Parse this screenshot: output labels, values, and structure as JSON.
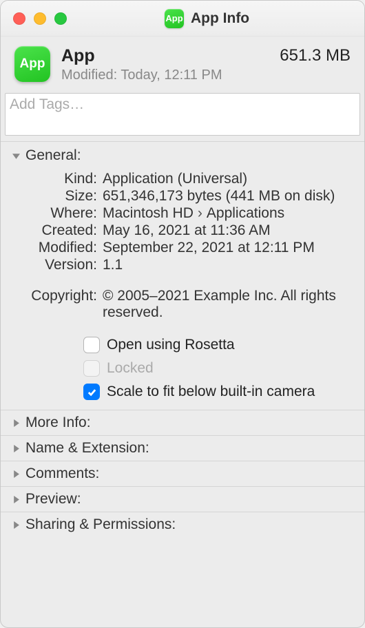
{
  "window": {
    "title": "App Info",
    "icon_text": "App"
  },
  "header": {
    "app_name": "App",
    "modified_label": "Modified:",
    "modified_value": "Today, 12:11 PM",
    "size": "651.3 MB",
    "icon_text": "App"
  },
  "tags": {
    "placeholder": "Add Tags…"
  },
  "sections": {
    "general": {
      "title": "General:",
      "rows": {
        "kind": {
          "label": "Kind:",
          "value": "Application (Universal)"
        },
        "size": {
          "label": "Size:",
          "value": "651,346,173 bytes (441 MB on disk)"
        },
        "where": {
          "label": "Where:",
          "value_a": "Macintosh HD",
          "value_b": "Applications"
        },
        "created": {
          "label": "Created:",
          "value": "May 16, 2021 at 11:36 AM"
        },
        "modified": {
          "label": "Modified:",
          "value": "September 22, 2021 at 12:11 PM"
        },
        "version": {
          "label": "Version:",
          "value": "1.1"
        },
        "copyright": {
          "label": "Copyright:",
          "value": "© 2005–2021 Example Inc. All rights reserved."
        }
      },
      "checkboxes": {
        "rosetta": {
          "label": "Open using Rosetta",
          "checked": false,
          "disabled": false
        },
        "locked": {
          "label": "Locked",
          "checked": false,
          "disabled": true
        },
        "scale_fit": {
          "label": "Scale to fit below built-in camera",
          "checked": true,
          "disabled": false
        }
      }
    },
    "collapsed": [
      {
        "title": "More Info:"
      },
      {
        "title": "Name & Extension:"
      },
      {
        "title": "Comments:"
      },
      {
        "title": "Preview:"
      },
      {
        "title": "Sharing & Permissions:"
      }
    ]
  }
}
